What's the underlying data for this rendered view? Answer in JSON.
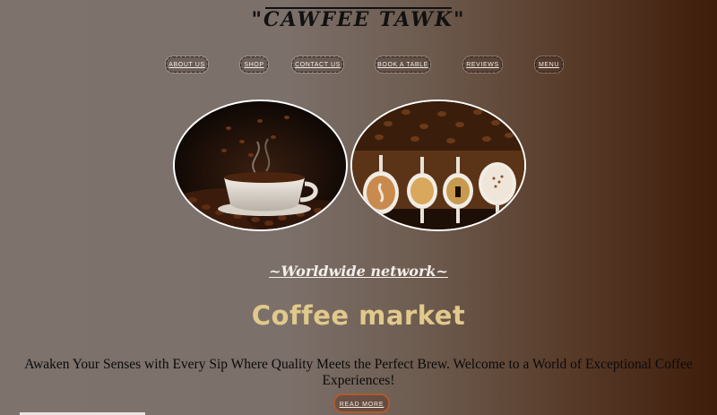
{
  "header": {
    "brand": "\"CAWFEE TAWK\""
  },
  "nav": {
    "items": [
      {
        "label": "ABOUT US"
      },
      {
        "label": "SHOP"
      },
      {
        "label": "CONTACT US"
      },
      {
        "label": "BOOK A TABLE"
      },
      {
        "label": "REVIEWS"
      },
      {
        "label": "MENU"
      }
    ]
  },
  "gallery": {
    "images": [
      {
        "name": "steaming-cup-on-beans-image"
      },
      {
        "name": "four-coffee-cups-image"
      }
    ]
  },
  "hero": {
    "subtitle": "~Worldwide network~",
    "title": "Coffee market",
    "tagline": "Awaken Your Senses with Every Sip Where Quality Meets the Perfect Brew. Welcome to a World of Exceptional Coffee Experiences!",
    "cta_label": "READ MORE"
  },
  "colors": {
    "title": "#e1c98c",
    "cta_border": "#b05a2c",
    "background_dark": "#3e1d0a",
    "background_light": "#7d726c"
  }
}
